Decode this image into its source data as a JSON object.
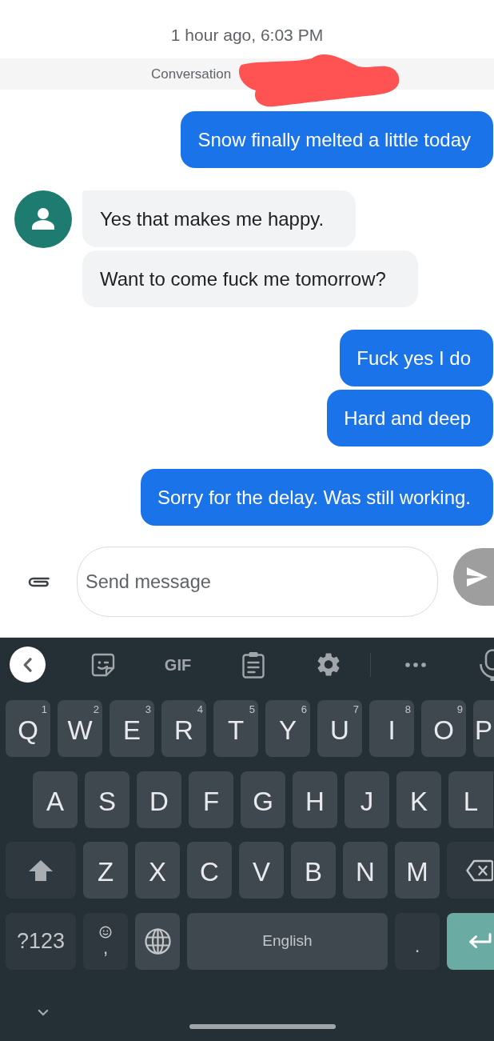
{
  "timestamp": "1 hour ago, 6:03 PM",
  "conversation_banner": {
    "label": "Conversation"
  },
  "message_groups": [
    {
      "kind": "sent",
      "messages": [
        "Snow finally melted a little today"
      ]
    },
    {
      "kind": "received",
      "messages": [
        "Yes that makes me happy.",
        "Want to come fuck me tomorrow?"
      ]
    },
    {
      "kind": "sent",
      "messages": [
        "Fuck yes I do",
        "Hard and deep"
      ]
    },
    {
      "kind": "sent",
      "messages": [
        "Sorry for the delay. Was still working."
      ]
    }
  ],
  "composer": {
    "placeholder": "Send message"
  },
  "keyboard": {
    "toolbar": {
      "gif_label": "GIF"
    },
    "rows": [
      {
        "keys": [
          {
            "kind": "letter",
            "label": "Q",
            "hint": "1"
          },
          {
            "kind": "letter",
            "label": "W",
            "hint": "2"
          },
          {
            "kind": "letter",
            "label": "E",
            "hint": "3"
          },
          {
            "kind": "letter",
            "label": "R",
            "hint": "4"
          },
          {
            "kind": "letter",
            "label": "T",
            "hint": "5"
          },
          {
            "kind": "letter",
            "label": "Y",
            "hint": "6"
          },
          {
            "kind": "letter",
            "label": "U",
            "hint": "7"
          },
          {
            "kind": "letter",
            "label": "I",
            "hint": "8"
          },
          {
            "kind": "letter",
            "label": "O",
            "hint": "9"
          },
          {
            "kind": "letter",
            "label": "P"
          }
        ]
      },
      {
        "keys": [
          {
            "kind": "letter",
            "label": "A"
          },
          {
            "kind": "letter",
            "label": "S"
          },
          {
            "kind": "letter",
            "label": "D"
          },
          {
            "kind": "letter",
            "label": "F"
          },
          {
            "kind": "letter",
            "label": "G"
          },
          {
            "kind": "letter",
            "label": "H"
          },
          {
            "kind": "letter",
            "label": "J"
          },
          {
            "kind": "letter",
            "label": "K"
          },
          {
            "kind": "letter",
            "label": "L"
          }
        ]
      },
      {
        "keys": [
          {
            "kind": "shift"
          },
          {
            "kind": "letter",
            "label": "Z"
          },
          {
            "kind": "letter",
            "label": "X"
          },
          {
            "kind": "letter",
            "label": "C"
          },
          {
            "kind": "letter",
            "label": "V"
          },
          {
            "kind": "letter",
            "label": "B"
          },
          {
            "kind": "letter",
            "label": "N"
          },
          {
            "kind": "letter",
            "label": "M"
          },
          {
            "kind": "backspace"
          }
        ]
      },
      {
        "keys": [
          {
            "kind": "symbols",
            "label": "?123"
          },
          {
            "kind": "emoji_comma",
            "label": ","
          },
          {
            "kind": "globe"
          },
          {
            "kind": "space",
            "label": "English"
          },
          {
            "kind": "punctuation",
            "label": "."
          },
          {
            "kind": "enter"
          }
        ]
      }
    ]
  }
}
